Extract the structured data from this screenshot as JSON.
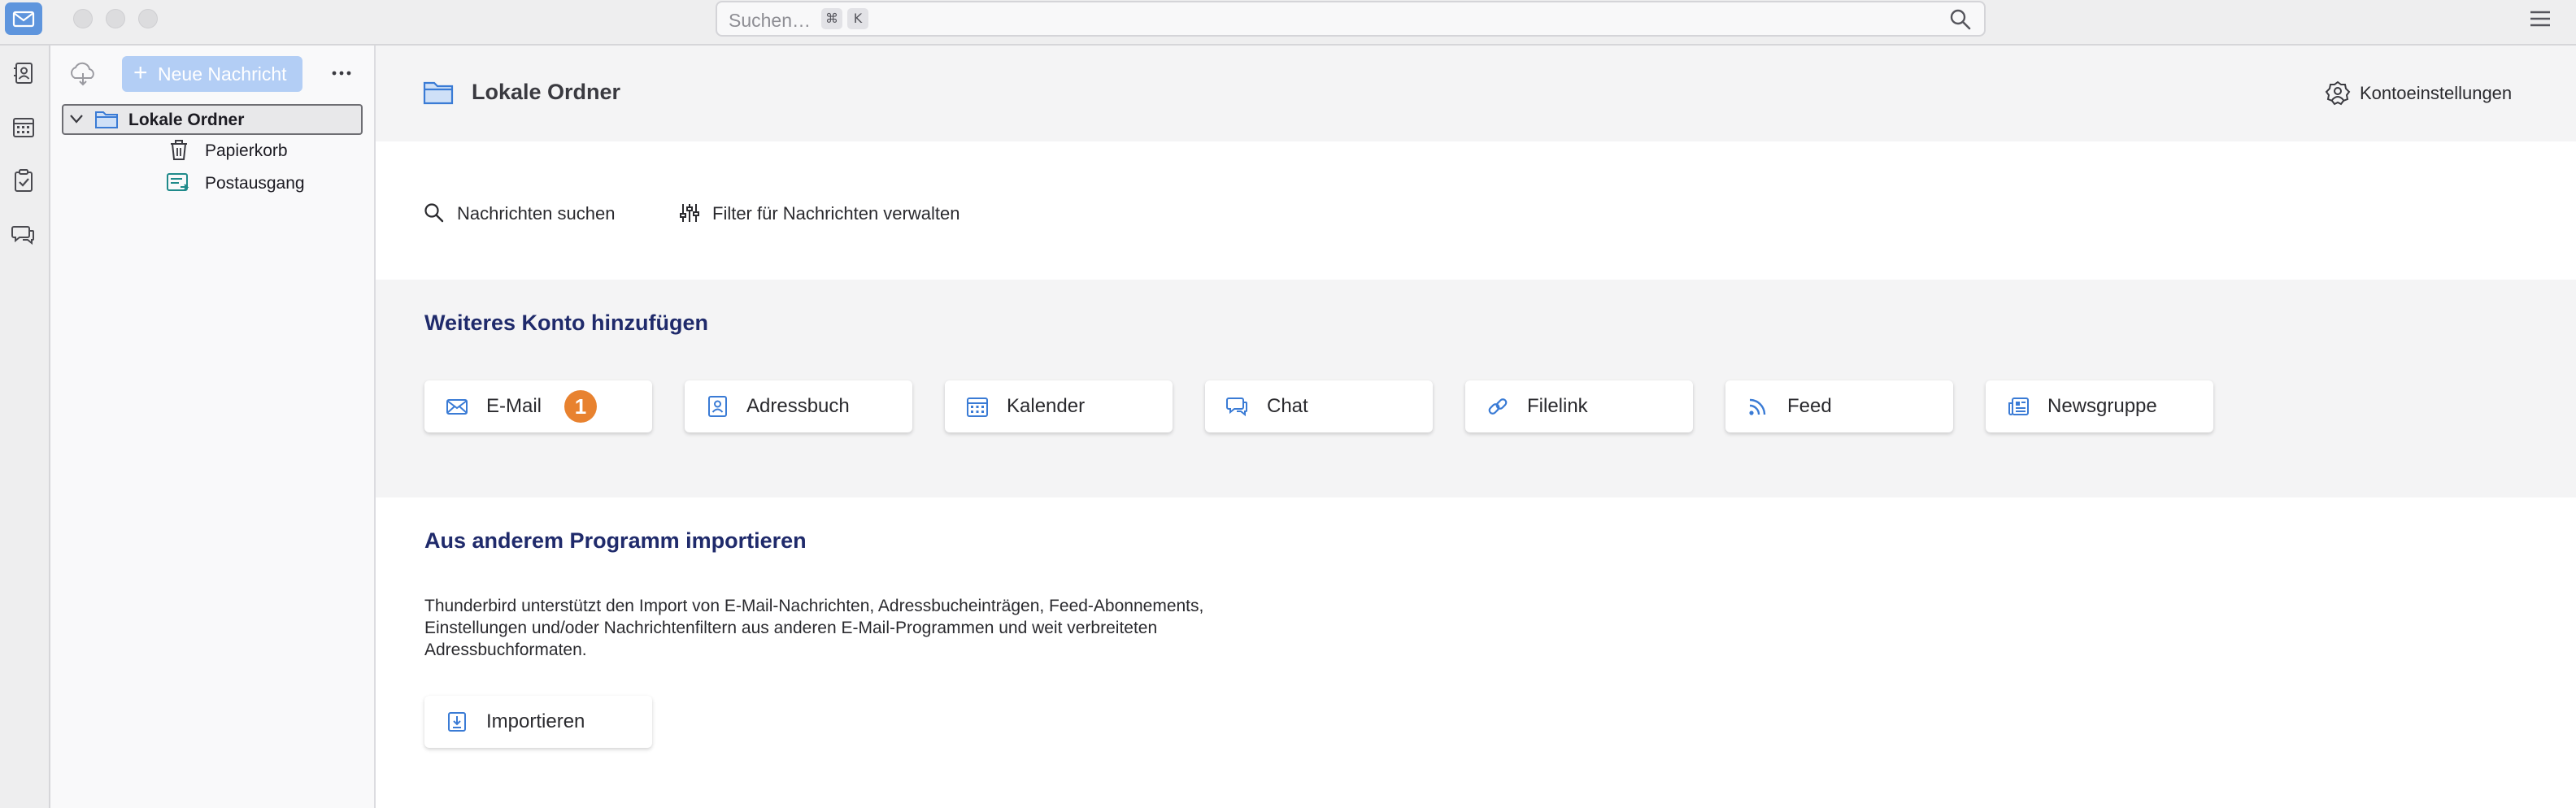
{
  "titlebar": {
    "search_placeholder": "Suchen…",
    "shortcut_cmd": "⌘",
    "shortcut_key": "K"
  },
  "folderpane": {
    "new_message_label": "Neue Nachricht",
    "more_label": "···",
    "tree": {
      "root": "Lokale Ordner",
      "children": [
        "Papierkorb",
        "Postausgang"
      ]
    }
  },
  "main": {
    "header_title": "Lokale Ordner",
    "account_settings": "Kontoeinstellungen",
    "search_messages": "Nachrichten suchen",
    "manage_filters": "Filter für Nachrichten verwalten",
    "add_account_title": "Weiteres Konto hinzufügen",
    "add_account_items": [
      "E-Mail",
      "Adressbuch",
      "Kalender",
      "Chat",
      "Filelink",
      "Feed",
      "Newsgruppe"
    ],
    "email_badge": "1",
    "import_title": "Aus anderem Programm importieren",
    "import_lines": [
      "Thunderbird unterstützt den Import von E-Mail-Nachrichten, Adressbucheinträgen, Feed-Abonnements,",
      "Einstellungen und/oder Nachrichtenfiltern aus anderen E-Mail-Programmen und weit verbreiteten",
      "Adressbuchformaten."
    ],
    "import_button": "Importieren"
  },
  "colors": {
    "accent": "#3a7bd5",
    "heading": "#1f2a6b",
    "badge": "#e8822f",
    "new_message_bg": "#b3cef5"
  }
}
